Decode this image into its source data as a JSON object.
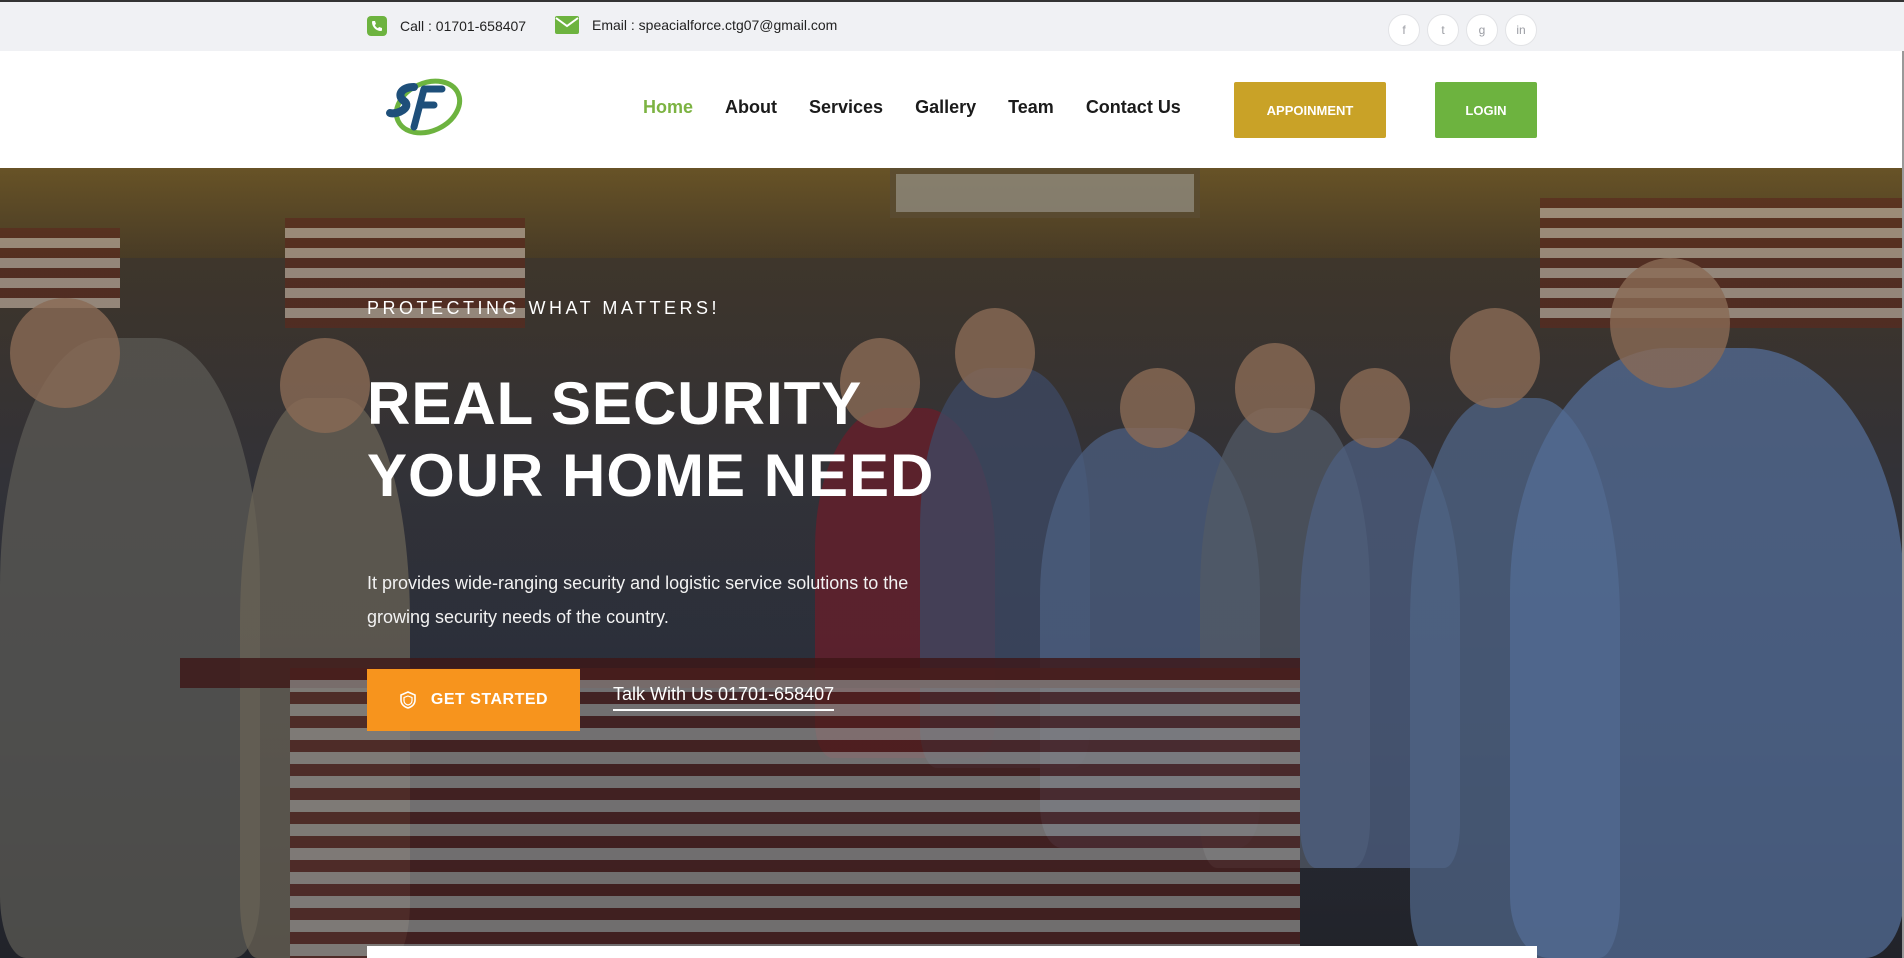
{
  "topbar": {
    "call_text": "Call : 01701-658407",
    "email_text": "Email : speacialforce.ctg07@gmail.com",
    "socials": [
      {
        "icon": "facebook-icon",
        "glyph": "f"
      },
      {
        "icon": "twitter-icon",
        "glyph": "t"
      },
      {
        "icon": "google-plus-icon",
        "glyph": "g"
      },
      {
        "icon": "linkedin-icon",
        "glyph": "in"
      }
    ]
  },
  "nav": {
    "items": [
      "Home",
      "About",
      "Services",
      "Gallery",
      "Team",
      "Contact Us"
    ],
    "active": "Home",
    "appointment_label": "APPOINMENT",
    "login_label": "LOGIN"
  },
  "hero": {
    "eyebrow": "PROTECTING WHAT MATTERS!",
    "headline_line1": "REAL SECURITY",
    "headline_line2": "YOUR HOME NEED",
    "description": "It provides wide-ranging security and logistic service solutions to the growing security needs of the country.",
    "cta_label": "GET STARTED",
    "talk_text": "Talk With Us 01701-658407"
  },
  "colors": {
    "accent_green": "#6db33f",
    "accent_gold": "#c9a227",
    "accent_orange": "#f7941d",
    "active_nav": "#7cb342"
  }
}
